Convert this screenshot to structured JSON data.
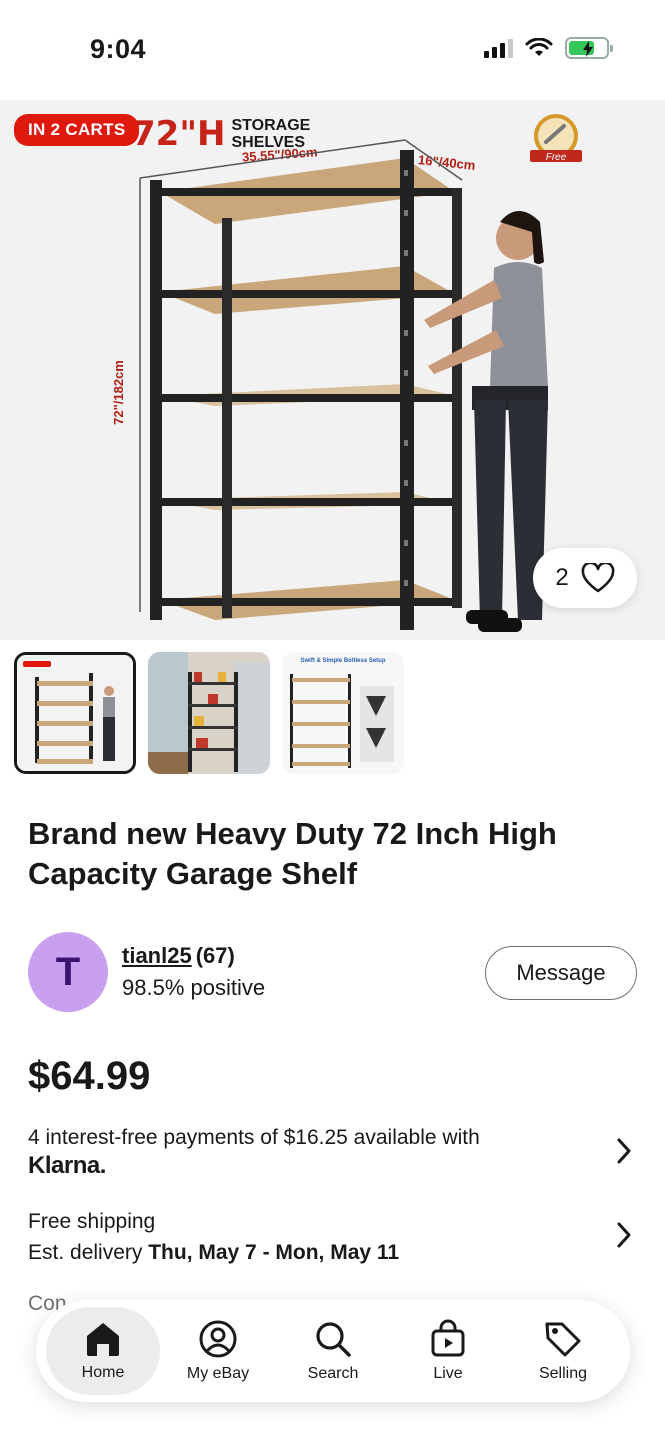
{
  "status_bar": {
    "time": "9:04"
  },
  "hero": {
    "carts_badge": "IN 2 CARTS",
    "brand_big": "72\"H",
    "brand_line1": "STORAGE",
    "brand_line2": "SHELVES",
    "width_dim": "35.55\"/90cm",
    "depth_dim": "16\"/40cm",
    "height_dim": "72\"/182cm",
    "free_label": "Free",
    "like_count": "2"
  },
  "thumbnails": [
    {
      "name": "thumb-shelf-with-model"
    },
    {
      "name": "thumb-pantry-shelf"
    },
    {
      "name": "thumb-assembly-setup",
      "caption": "Swift & Simple Boltless Setup"
    }
  ],
  "listing": {
    "title": "Brand new Heavy Duty 72 Inch High Capacity Garage Shelf",
    "price": "$64.99"
  },
  "seller": {
    "avatar_letter": "T",
    "name": "tianl25",
    "score": "(67)",
    "feedback": "98.5% positive",
    "message_label": "Message"
  },
  "payments": {
    "text": "4 interest-free payments of $16.25 available with",
    "provider": "Klarna."
  },
  "shipping": {
    "label": "Free shipping",
    "delivery_prefix": "Est. delivery",
    "delivery_dates": "Thu, May 7 - Mon, May 11"
  },
  "condition_peek": "Con",
  "nav": {
    "items": [
      {
        "label": "Home",
        "icon": "home-icon"
      },
      {
        "label": "My eBay",
        "icon": "profile-icon"
      },
      {
        "label": "Search",
        "icon": "search-icon"
      },
      {
        "label": "Live",
        "icon": "live-bag-icon"
      },
      {
        "label": "Selling",
        "icon": "tag-icon"
      }
    ]
  },
  "colors": {
    "accent_red": "#e0190f",
    "avatar": "#c9a0f0",
    "text": "#191919"
  }
}
